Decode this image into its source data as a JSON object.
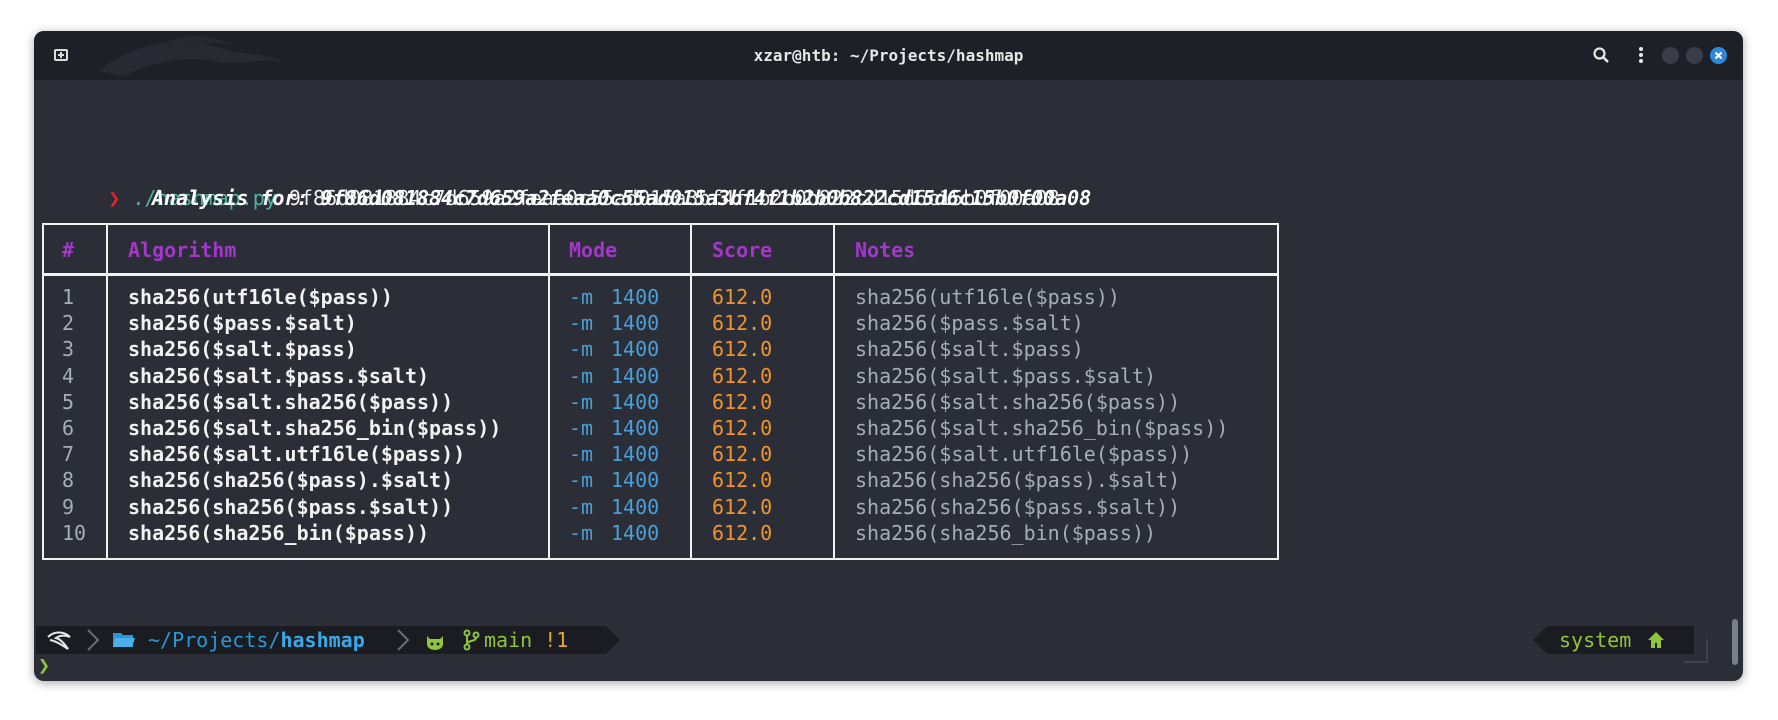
{
  "window": {
    "title": "xzar@htb: ~/Projects/hashmap"
  },
  "icons": {
    "new_tab": "new-tab-icon",
    "search": "search-icon",
    "menu": "kebab-menu-icon",
    "close": "close-icon"
  },
  "command": {
    "prompt_symbol": "❯",
    "program": "./hashmap.py",
    "argument": "9f86d081884c7d659a2feaa0c55ad015a3bf4f1b2b0b822cd15d6c15b0f00a08"
  },
  "analysis_header": "Analysis for: 9f86d081884c7d659a2feaa0c55ad015a3bf4f1b2b0b822cd15d6c15b0f00a08",
  "table": {
    "headers": [
      "#",
      "Algorithm",
      "Mode",
      "Score",
      "Notes"
    ],
    "rows": [
      {
        "n": "1",
        "alg": "sha256(utf16le($pass))",
        "flag": "-m",
        "mode": "1400",
        "score": "612.0",
        "notes": "sha256(utf16le($pass))"
      },
      {
        "n": "2",
        "alg": "sha256($pass.$salt)",
        "flag": "-m",
        "mode": "1400",
        "score": "612.0",
        "notes": "sha256($pass.$salt)"
      },
      {
        "n": "3",
        "alg": "sha256($salt.$pass)",
        "flag": "-m",
        "mode": "1400",
        "score": "612.0",
        "notes": "sha256($salt.$pass)"
      },
      {
        "n": "4",
        "alg": "sha256($salt.$pass.$salt)",
        "flag": "-m",
        "mode": "1400",
        "score": "612.0",
        "notes": "sha256($salt.$pass.$salt)"
      },
      {
        "n": "5",
        "alg": "sha256($salt.sha256($pass))",
        "flag": "-m",
        "mode": "1400",
        "score": "612.0",
        "notes": "sha256($salt.sha256($pass))"
      },
      {
        "n": "6",
        "alg": "sha256($salt.sha256_bin($pass))",
        "flag": "-m",
        "mode": "1400",
        "score": "612.0",
        "notes": "sha256($salt.sha256_bin($pass))"
      },
      {
        "n": "7",
        "alg": "sha256($salt.utf16le($pass))",
        "flag": "-m",
        "mode": "1400",
        "score": "612.0",
        "notes": "sha256($salt.utf16le($pass))"
      },
      {
        "n": "8",
        "alg": "sha256(sha256($pass).$salt)",
        "flag": "-m",
        "mode": "1400",
        "score": "612.0",
        "notes": "sha256(sha256($pass).$salt)"
      },
      {
        "n": "9",
        "alg": "sha256(sha256($pass.$salt))",
        "flag": "-m",
        "mode": "1400",
        "score": "612.0",
        "notes": "sha256(sha256($pass.$salt))"
      },
      {
        "n": "10",
        "alg": "sha256(sha256_bin($pass))",
        "flag": "-m",
        "mode": "1400",
        "score": "612.0",
        "notes": "sha256(sha256_bin($pass))"
      }
    ]
  },
  "statusbar": {
    "path_home": "~/Projects/",
    "path_dir": "hashmap",
    "branch": "main",
    "changes": "!1",
    "env": "system"
  },
  "final_prompt": "❯",
  "colors": {
    "terminal_bg": "#2b2e37",
    "titlebar_bg": "#1e2027",
    "header_purple": "#a238c9",
    "mode_blue": "#4a9fd8",
    "score_orange": "#f2942b",
    "git_green": "#8ec53c",
    "prompt_red": "#e0242b"
  }
}
